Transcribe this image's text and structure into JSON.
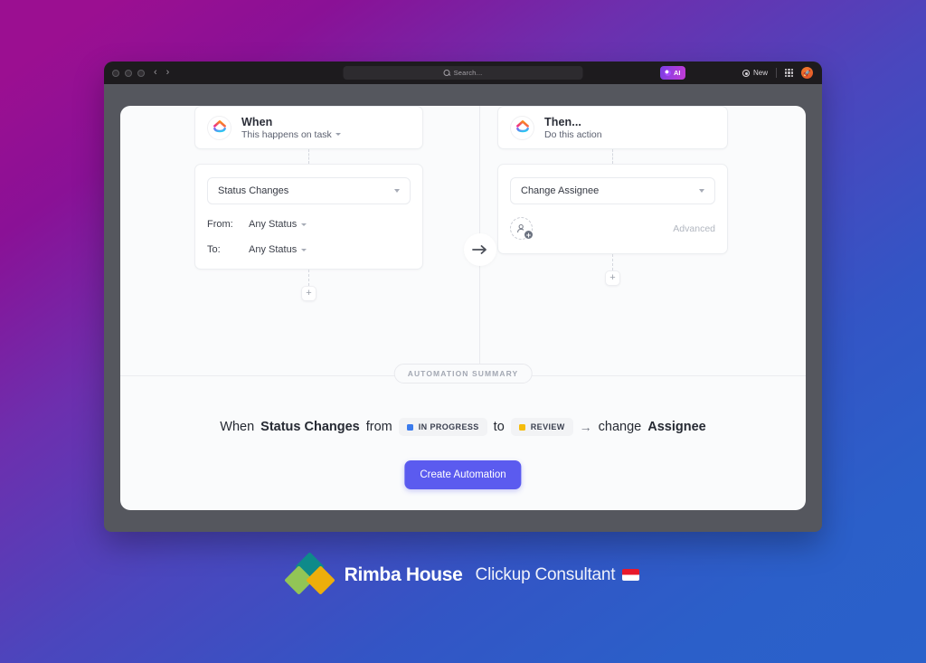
{
  "browser": {
    "search_placeholder": "Search...",
    "ai_label": "AI",
    "new_label": "New",
    "avatar_glyph": "🚀"
  },
  "builder": {
    "when": {
      "title": "When",
      "subtitle": "This happens on task",
      "trigger": "Status Changes",
      "from_label": "From:",
      "from_value": "Any Status",
      "to_label": "To:",
      "to_value": "Any Status",
      "add_label": "+"
    },
    "then": {
      "title": "Then...",
      "subtitle": "Do this action",
      "action": "Change Assignee",
      "advanced_label": "Advanced",
      "add_person_label": "+",
      "add_label": "+"
    }
  },
  "summary": {
    "pill": "AUTOMATION SUMMARY",
    "prefix": "When",
    "trigger": "Status Changes",
    "from_word": "from",
    "from_status": "IN PROGRESS",
    "from_status_color": "#3b7bed",
    "to_word": "to",
    "to_status": "REVIEW",
    "to_status_color": "#f5bc0b",
    "arrow": "→",
    "action_verb": "change",
    "action_object": "Assignee",
    "create_button": "Create Automation"
  },
  "brand": {
    "name": "Rimba House",
    "tagline": "Clickup Consultant",
    "flag": "id-flag"
  },
  "colors": {
    "accent": "#5b5bef",
    "bg_start": "#9b0f91",
    "bg_end": "#2a61ca"
  }
}
